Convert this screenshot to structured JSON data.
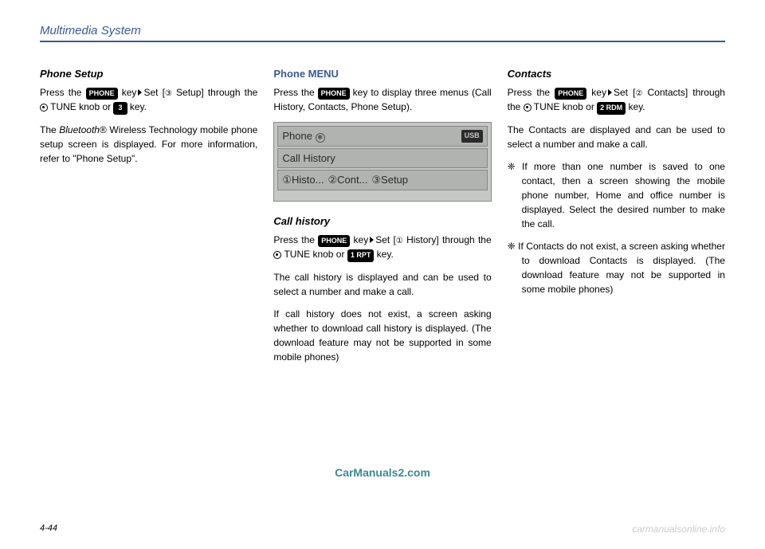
{
  "header": "Multimedia System",
  "col1": {
    "h1": "Phone Setup",
    "p1a": "Press the ",
    "key_phone": "PHONE",
    "p1b": " key",
    "p1c": "Set [",
    "circled3": "③",
    "p1d": " Setup] through the ",
    "p1e": " TUNE knob or ",
    "key_3": "3",
    "p1f": " key.",
    "p2a": "The ",
    "p2b": "Bluetooth",
    "p2c": "®",
    "p2d": " Wireless Technology mobile phone setup screen is displayed. For more information, refer to \"Phone Setup\"."
  },
  "col2": {
    "h1": "Phone MENU",
    "p1a": "Press the ",
    "key_phone": "PHONE",
    "p1b": " key to display three menus (Call History, Contacts, Phone Setup).",
    "display": {
      "title": "Phone",
      "usb": "USB",
      "row2": "Call History",
      "row3a": "①Histo...",
      "row3b": "②Cont...",
      "row3c": "③Setup"
    },
    "h2": "Call history",
    "p2a": "Press the ",
    "p2b": " key",
    "p2c": "Set [",
    "circled1": "①",
    "p2d": " History] through the ",
    "p2e": " TUNE knob or ",
    "key_1rpt": "1 RPT",
    "p2f": " key.",
    "p3": "The call history is displayed and can be used to select a number and make a call.",
    "p4": "If call history does not exist, a screen asking whether to download call history is displayed. (The download feature may not be supported in some mobile phones)"
  },
  "col3": {
    "h1": "Contacts",
    "p1a": "Press the ",
    "key_phone": "PHONE",
    "p1b": " key",
    "p1c": "Set [",
    "circled2": "②",
    "p1d": " Contacts] through the ",
    "p1e": " TUNE knob or ",
    "key_2rdm": "2 RDM",
    "p1f": " key.",
    "p2": "The Contacts are displayed and can be used to select a number and make a call.",
    "b1": "❈ If more than one number is saved to one contact, then a screen showing the mobile phone number, Home and office number is displayed. Select the desired number to make the call.",
    "b2": "❈ If Contacts do not exist, a screen asking whether to download Contacts is displayed. (The download feature may not be supported in some mobile phones)"
  },
  "watermark": "CarManuals2.com",
  "pagenum": "4-44",
  "footermark": "carmanualsonline.info"
}
